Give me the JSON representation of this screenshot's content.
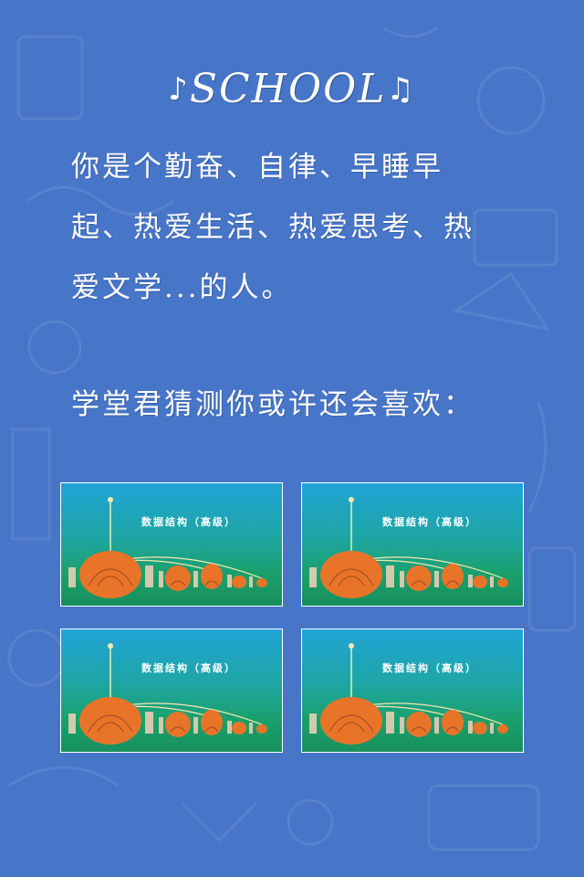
{
  "logo": {
    "text": "SCHOOL",
    "note_left": "♪",
    "note_right": "♫"
  },
  "intro": {
    "line1": "你是个勤奋、自律、早睡早",
    "line2": "起、热爱生活、热爱思考、热",
    "line3": "爱文学...的人。"
  },
  "suggest_heading": "学堂君猜测你或许还会喜欢：",
  "cards": [
    {
      "title": "数据结构（高级）"
    },
    {
      "title": "数据结构（高级）"
    },
    {
      "title": "数据结构（高级）"
    },
    {
      "title": "数据结构（高级）"
    }
  ],
  "colors": {
    "background": "#4775c8",
    "card_top": "#20a3d7",
    "card_bottom": "#18905d",
    "tree_orange": "#e8742a",
    "pole": "#f3e9b0"
  }
}
